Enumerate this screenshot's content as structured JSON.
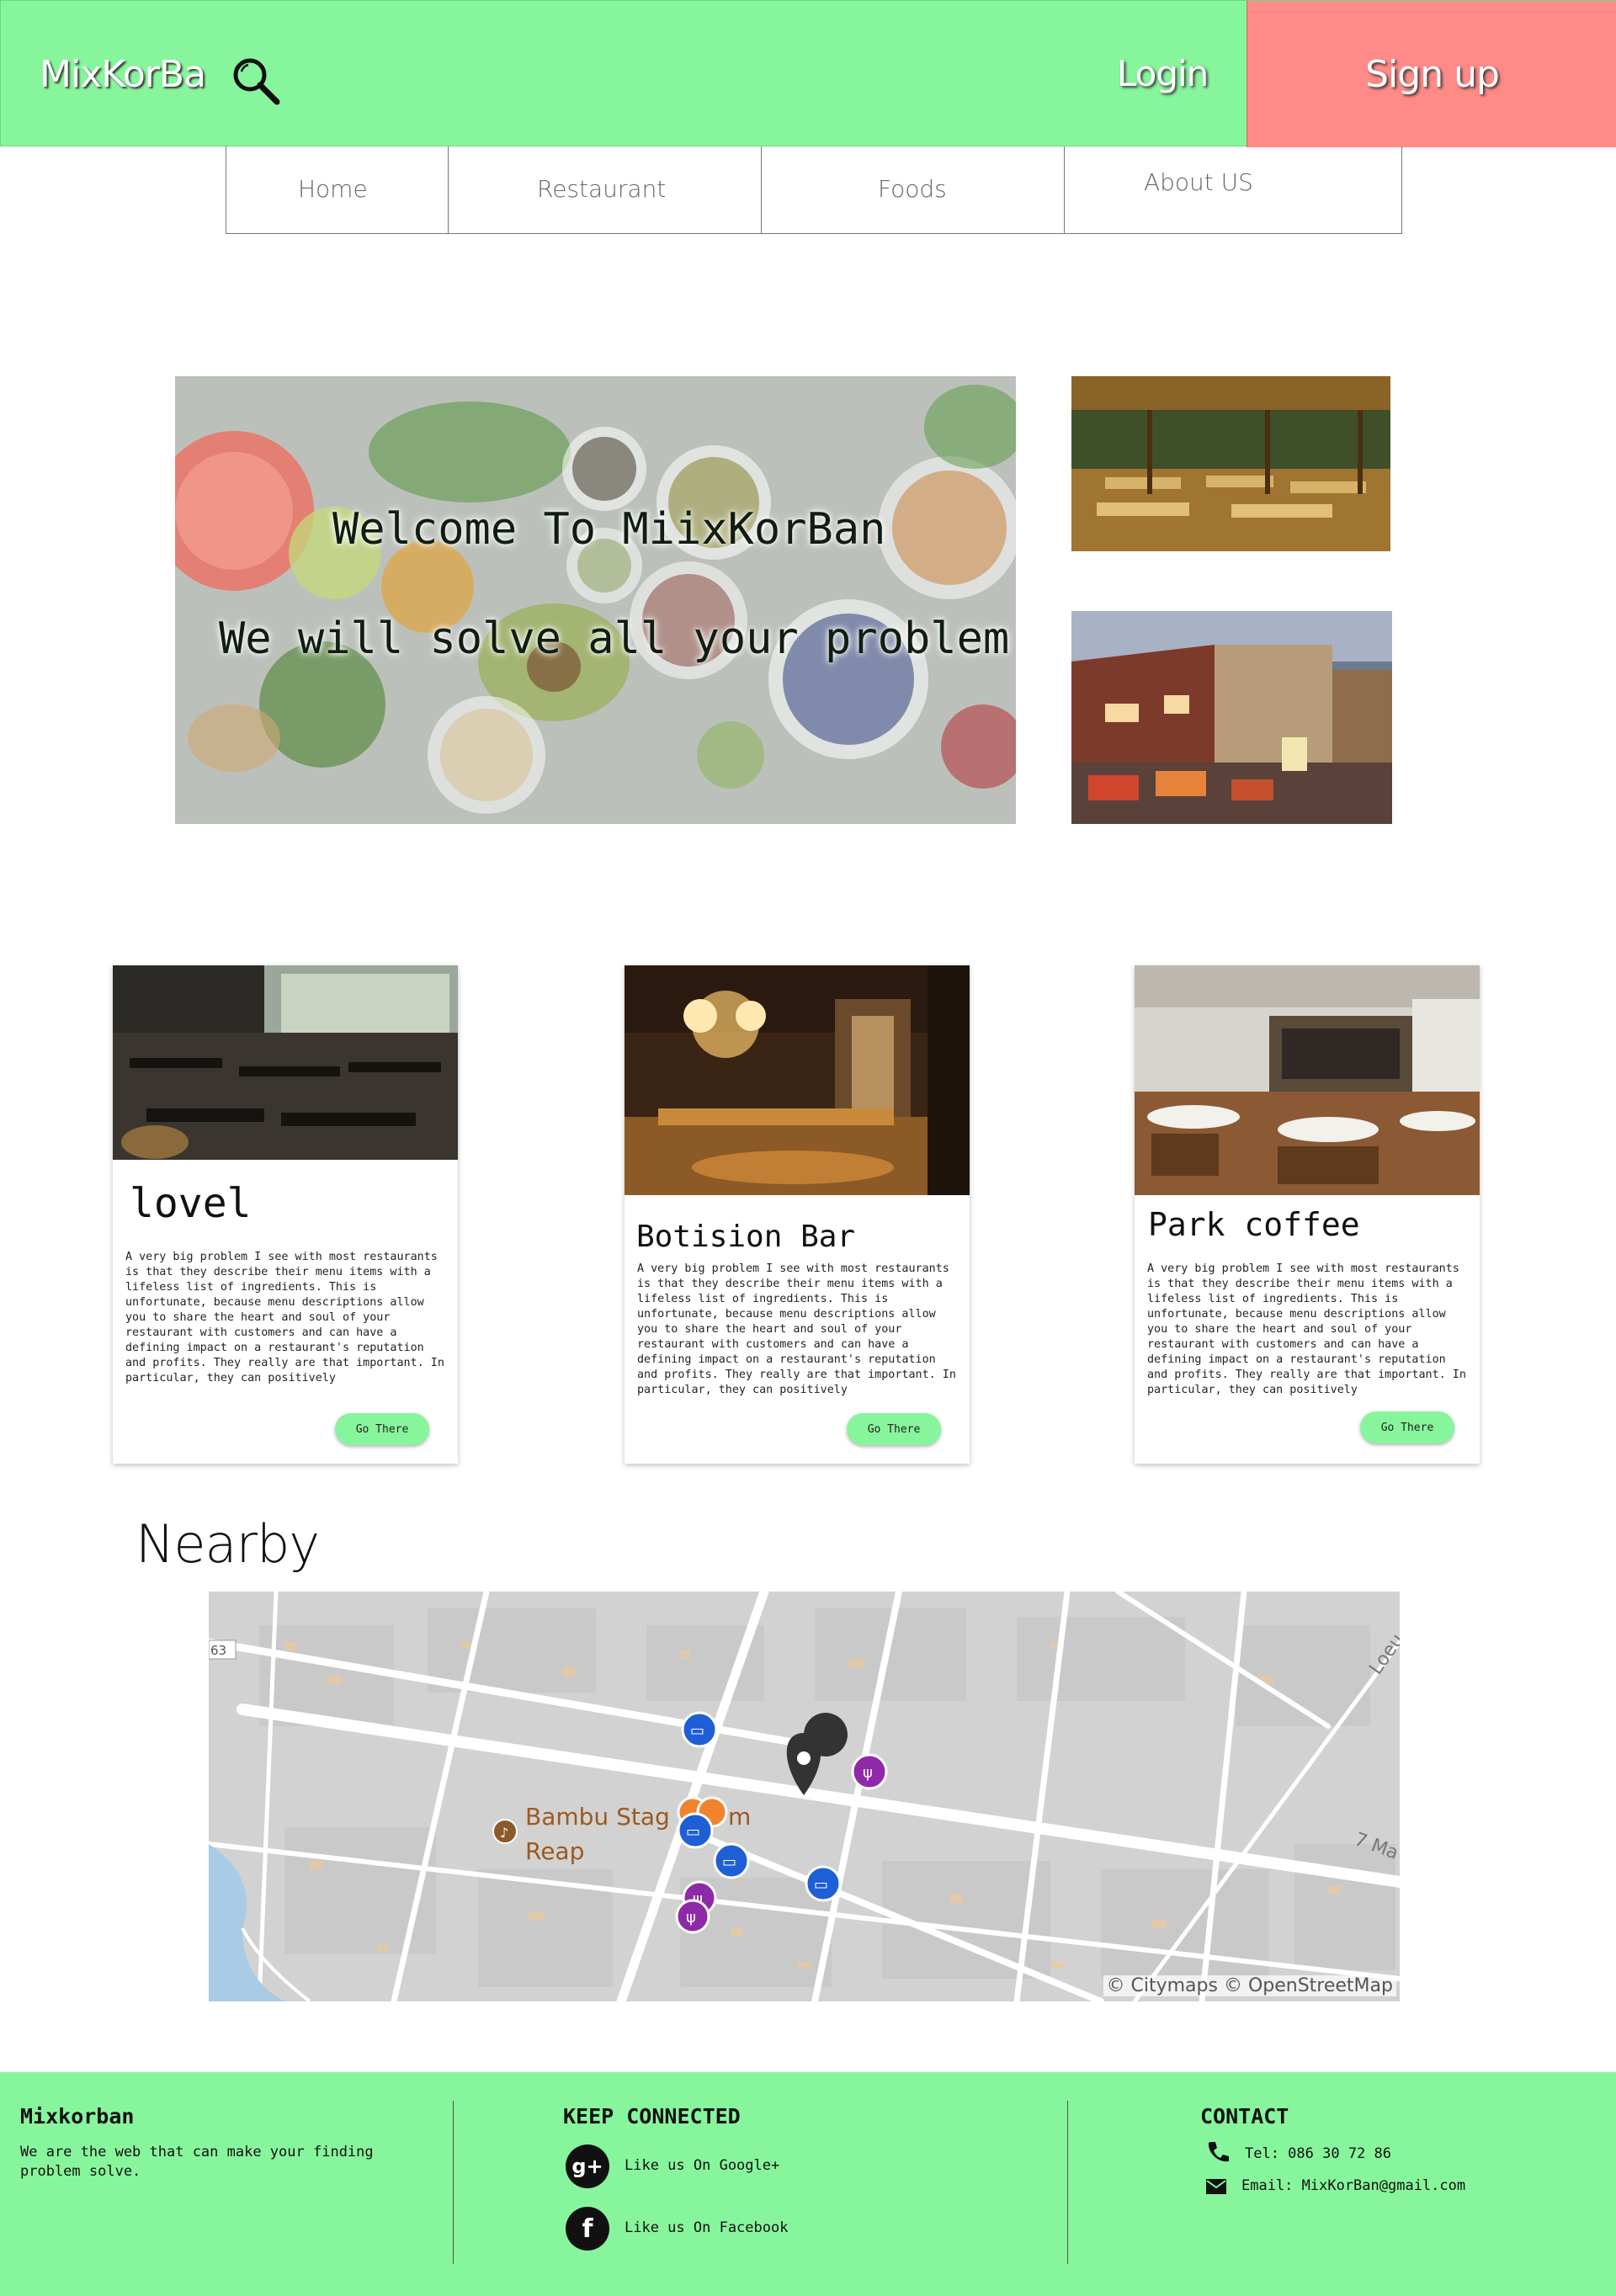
{
  "header": {
    "brand": "MixKorBa",
    "login": "Login",
    "signup": "Sign up"
  },
  "nav": {
    "items": [
      {
        "label": "Home"
      },
      {
        "label": "Restaurant"
      },
      {
        "label": "Foods"
      },
      {
        "label": "About US"
      }
    ]
  },
  "hero": {
    "line1": "Welcome To MiixKorBan",
    "line2": "We will solve all your problem"
  },
  "cards": [
    {
      "title": "lovel",
      "description": "A very big problem I see with most restaurants is that they describe their menu items with a lifeless list of ingredients. This is unfortunate, because menu descriptions allow you to share the heart and soul of your restaurant with customers and can have a defining impact on a restaurant's reputation and profits. They really are that important. In particular, they can positively",
      "button": "Go There"
    },
    {
      "title": "Botision Bar",
      "description": "A very big problem I see with most restaurants is that they describe their menu items with a lifeless list of ingredients. This is unfortunate, because menu descriptions allow you to share the heart and soul of your restaurant with customers and can have a defining impact on a restaurant's reputation and profits. They really are that important. In particular, they can positively",
      "button": "Go There"
    },
    {
      "title": "Park coffee",
      "description": "A very big problem I see with most restaurants is that they describe their menu items with a lifeless list of ingredients. This is unfortunate, because menu descriptions allow you to share the heart and soul of your restaurant with customers and can have a defining impact on a restaurant's reputation and profits. They really are that important. In particular, they can positively",
      "button": "Go There"
    }
  ],
  "nearby": {
    "title": "Nearby",
    "map": {
      "place_label_1": "Bambu Stag",
      "place_label_1b": "m",
      "place_label_2": "Reap",
      "road_label_1": "Loeu",
      "road_label_2": "7 Ma",
      "road_number": "63",
      "credit": "© Citymaps © OpenStreetMap"
    }
  },
  "footer": {
    "brand": "Mixkorban",
    "tagline": "We are the web that can make your finding problem solve.",
    "connect_title": "KEEP CONNECTED",
    "google": "Like us On Google+",
    "facebook": "Like us On Facebook",
    "contact_title": "CONTACT",
    "tel": "Tel: 086 30 72 86",
    "email": "Email: MixKorBan@gmail.com"
  },
  "colors": {
    "accent_green": "#87f59c",
    "signup_red": "#ff8a87"
  }
}
